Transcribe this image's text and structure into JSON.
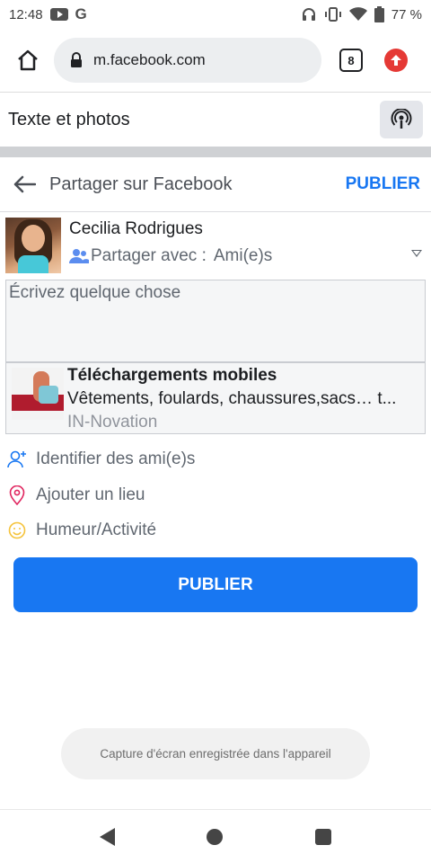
{
  "status_bar": {
    "time": "12:48",
    "battery": "77 %"
  },
  "browser": {
    "url": "m.facebook.com",
    "tab_count": "8"
  },
  "top_row": {
    "label": "Texte et photos"
  },
  "share": {
    "title": "Partager sur Facebook",
    "publish_link": "PUBLIER"
  },
  "user": {
    "name": "Cecilia Rodrigues",
    "audience_prefix": "Partager avec :",
    "audience_value": "Ami(e)s"
  },
  "composer": {
    "placeholder": "Écrivez quelque chose"
  },
  "link_preview": {
    "title": "Téléchargements mobiles",
    "description": "Vêtements, foulards, chaussures,sacs… t...",
    "source": "IN-Novation"
  },
  "options": {
    "tag": "Identifier des ami(e)s",
    "location": "Ajouter un lieu",
    "mood": "Humeur/Activité"
  },
  "publish_button": "PUBLIER",
  "toast": "Capture d'écran enregistrée dans l'appareil",
  "colors": {
    "accent": "#1877f2",
    "location_icon": "#e0245e",
    "mood_icon": "#f5c33b",
    "tag_icon": "#1877f2"
  }
}
